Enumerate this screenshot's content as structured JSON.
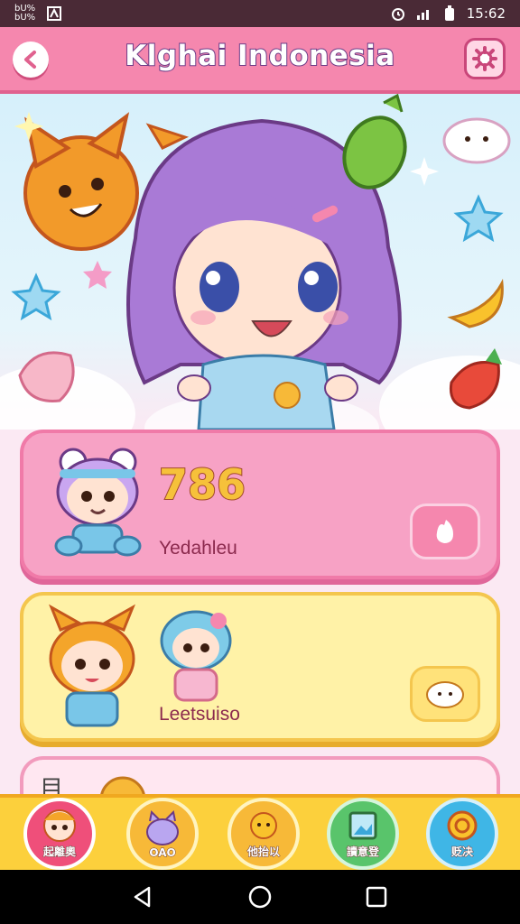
{
  "status_bar": {
    "carrier": "bU% \nbU%",
    "time": "15:62"
  },
  "header": {
    "title": "Klghai Indonesia"
  },
  "cards": [
    {
      "score": "786",
      "label": "Yedahleu"
    },
    {
      "label": "Leetsuiso"
    },
    {
      "label": "目"
    }
  ],
  "bottom_nav": [
    {
      "label": "起離奧",
      "color": "#ef4f7a"
    },
    {
      "label": "OAO",
      "color": "#f7b938"
    },
    {
      "label": "他抬以",
      "color": "#f7b938"
    },
    {
      "label": "讀意登",
      "color": "#59c46b"
    },
    {
      "label": "贬决",
      "color": "#3fb6e6"
    }
  ]
}
